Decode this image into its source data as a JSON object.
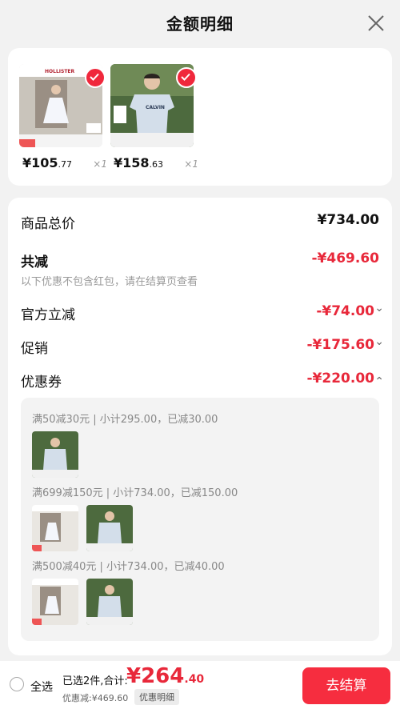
{
  "header": {
    "title": "金额明细"
  },
  "products": [
    {
      "price_main": "¥105",
      "price_dec": ".77",
      "qty": "×1"
    },
    {
      "price_main": "¥158",
      "price_dec": ".63",
      "qty": "×1"
    }
  ],
  "summary": {
    "total_label": "商品总价",
    "total_value": "¥734.00",
    "discount_label": "共减",
    "discount_value": "-¥469.60",
    "discount_note": "以下优惠不包含红包，请在结算页查看",
    "items": [
      {
        "label": "官方立减",
        "value": "-¥74.00",
        "arrow": "⌄"
      },
      {
        "label": "促销",
        "value": "-¥175.60",
        "arrow": "⌄"
      },
      {
        "label": "优惠券",
        "value": "-¥220.00",
        "arrow": "⌃"
      }
    ]
  },
  "coupons": [
    {
      "text": "满50减30元 | 小计295.00，已减30.00"
    },
    {
      "text": "满699减150元 | 小计734.00，已减150.00"
    },
    {
      "text": "满500减40元 | 小计734.00，已减40.00"
    }
  ],
  "bottom": {
    "select_all": "全选",
    "selected": "已选2件,合计:",
    "total_main": "¥264",
    "total_dec": ".40",
    "discount": "优惠减:¥469.60",
    "detail": "优惠明细",
    "checkout": "去结算"
  },
  "colors": {
    "accent": "#e8283a",
    "button": "#f62d3f"
  }
}
